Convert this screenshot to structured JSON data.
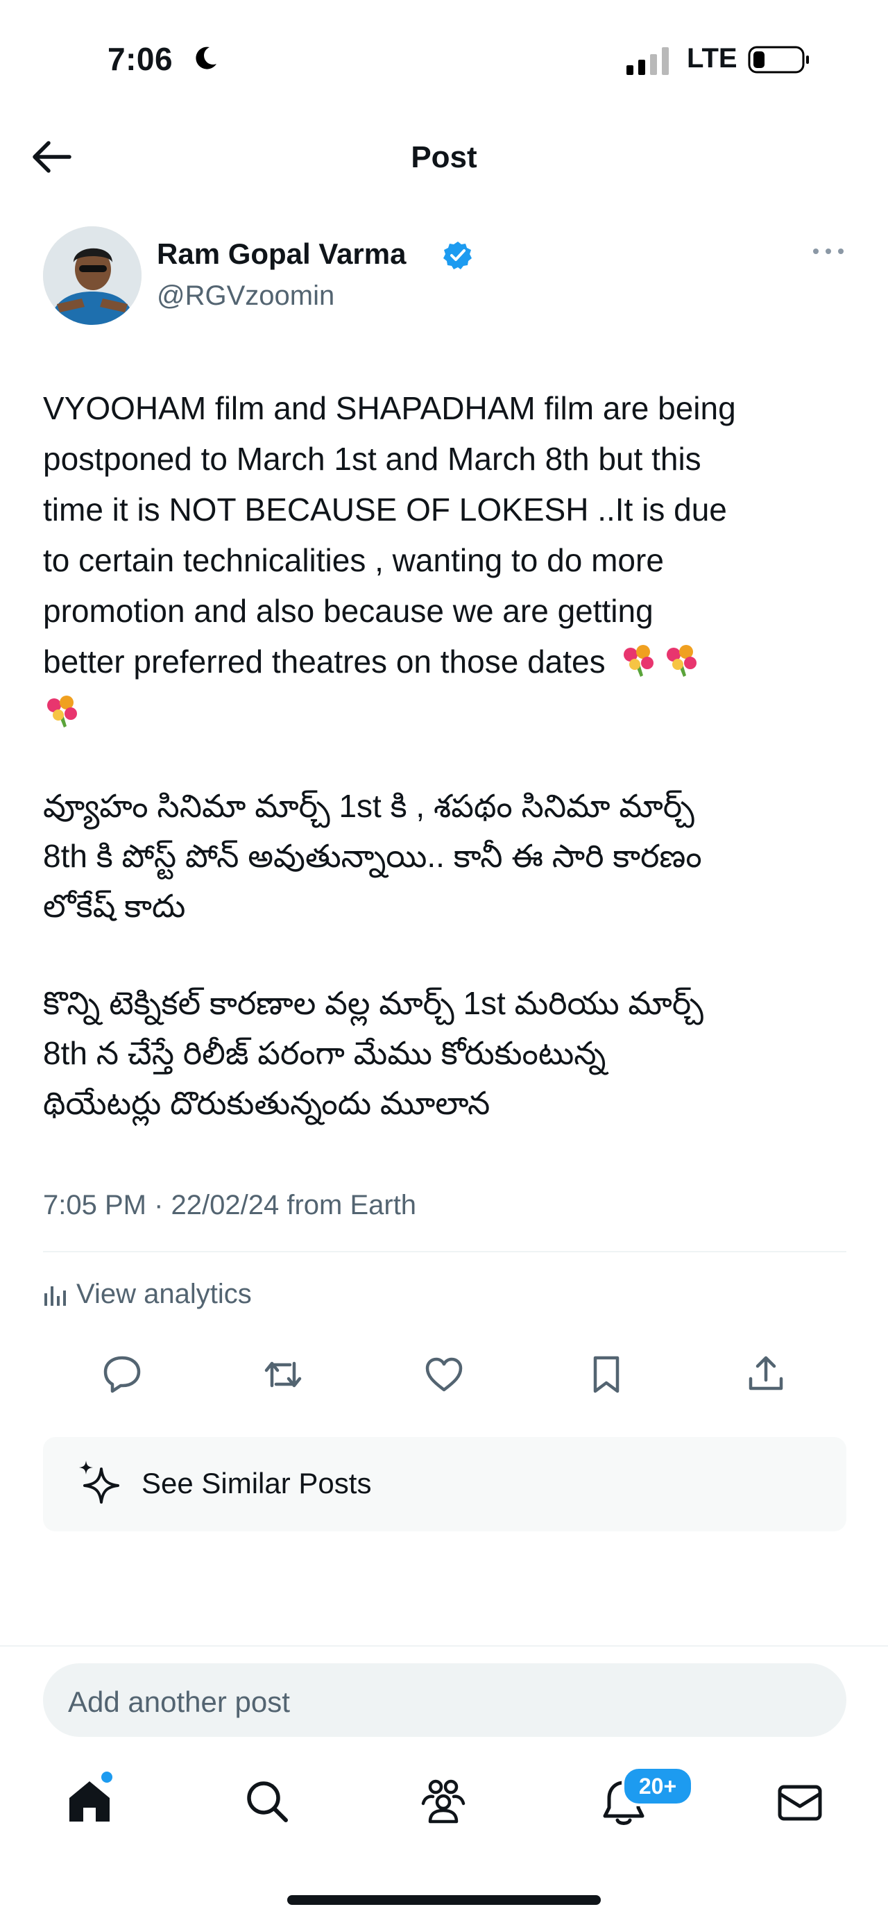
{
  "status_bar": {
    "time": "7:06",
    "network": "LTE"
  },
  "header": {
    "title": "Post"
  },
  "author": {
    "name": "Ram Gopal Varma",
    "handle": "@RGVzoomin"
  },
  "post": {
    "english_lines": [
      "VYOOHAM film and SHAPADHAM film are being",
      "postponed to March 1st and March 8th but this",
      "time it is NOT BECAUSE OF LOKESH ..It is due",
      "to certain technicalities , wanting to do more",
      "promotion and also because we are getting",
      "better preferred theatres on those dates"
    ],
    "telugu_para1_lines": [
      "వ్యూహం సినిమా మార్చ్ 1st కి , శపథం సినిమా మార్చ్",
      "8th కి పోస్ట్ పోన్ అవుతున్నాయి.. కానీ ఈ సారి కారణం",
      "లోకేష్ కాదు"
    ],
    "telugu_para2_lines": [
      "కొన్ని టెక్నికల్ కారణాల వల్ల మార్చ్ 1st మరియు మార్చ్",
      "8th న చేస్తే రిలీజ్ పరంగా మేము కోరుకుంటున్న",
      "థియేటర్లు దొరుకుతున్నందు మూలాన"
    ],
    "meta": "7:05 PM · 22/02/24 from Earth"
  },
  "analytics": {
    "label": "View analytics"
  },
  "actions": {
    "icons": [
      "reply-icon",
      "repost-icon",
      "like-icon",
      "bookmark-icon",
      "share-icon"
    ]
  },
  "similar": {
    "label": "See Similar Posts"
  },
  "reply": {
    "placeholder": "Add another post"
  },
  "bottom_nav": {
    "icons": [
      "home-icon",
      "search-icon",
      "communities-icon",
      "notifications-icon",
      "messages-icon"
    ],
    "notifications_badge": "20+"
  },
  "colors": {
    "accent": "#1d9bf0",
    "text": "#0f1419",
    "secondary_text": "#536471"
  }
}
